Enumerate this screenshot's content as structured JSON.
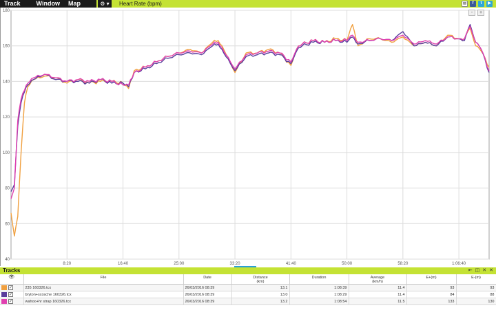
{
  "menu": {
    "items": [
      "Track",
      "Window",
      "Map"
    ]
  },
  "gear_label": "⚙ ▾",
  "chart_title": "Heart Rate (bpm)",
  "zoom": {
    "out": "-",
    "in": "+"
  },
  "colors": {
    "accent": "#c4e234",
    "orange": "#f0a040",
    "purple": "#5a3c9c",
    "magenta": "#e040b0"
  },
  "chart_data": {
    "type": "line",
    "title": "Heart Rate (bpm)",
    "xlabel": "",
    "ylabel": "",
    "ylim": [
      40,
      180
    ],
    "yticks": [
      40,
      60,
      80,
      100,
      120,
      140,
      160,
      180
    ],
    "xlim": [
      0,
      4270
    ],
    "xticks": [
      500,
      1000,
      1500,
      2000,
      2500,
      3000,
      3500,
      4000
    ],
    "xtick_labels": [
      "8:20",
      "16:40",
      "25:00",
      "33:20",
      "41:40",
      "50:00",
      "58:20",
      "1:06:40"
    ],
    "x_unit": "seconds",
    "series": [
      {
        "name": "235 160326.tcx",
        "color": "#f0a040",
        "x": [
          0,
          30,
          60,
          90,
          120,
          150,
          200,
          300,
          400,
          500,
          600,
          700,
          800,
          900,
          1000,
          1050,
          1100,
          1200,
          1300,
          1400,
          1500,
          1600,
          1700,
          1800,
          1850,
          1900,
          2000,
          2100,
          2200,
          2300,
          2400,
          2500,
          2550,
          2600,
          2700,
          2800,
          2900,
          3000,
          3050,
          3100,
          3200,
          3300,
          3400,
          3500,
          3600,
          3700,
          3800,
          3900,
          4000,
          4050,
          4100,
          4150,
          4200,
          4270
        ],
        "y": [
          66,
          53,
          64,
          100,
          128,
          137,
          141,
          143,
          142,
          139,
          141,
          139,
          140,
          140,
          139,
          136,
          146,
          148,
          151,
          154,
          156,
          158,
          156,
          162,
          163,
          158,
          145,
          156,
          156,
          158,
          156,
          149,
          158,
          161,
          163,
          162,
          164,
          163,
          172,
          160,
          164,
          164,
          162,
          165,
          160,
          162,
          160,
          166,
          164,
          164,
          170,
          160,
          157,
          148
        ]
      },
      {
        "name": "bryton+scosche 160326.tcx",
        "color": "#5a3c9c",
        "x": [
          0,
          30,
          60,
          90,
          120,
          150,
          200,
          300,
          400,
          500,
          600,
          700,
          800,
          900,
          1000,
          1050,
          1100,
          1200,
          1300,
          1400,
          1500,
          1600,
          1700,
          1800,
          1850,
          1900,
          2000,
          2100,
          2200,
          2300,
          2400,
          2500,
          2550,
          2600,
          2700,
          2800,
          2900,
          3000,
          3050,
          3100,
          3200,
          3300,
          3400,
          3500,
          3600,
          3700,
          3800,
          3900,
          4000,
          4050,
          4100,
          4150,
          4200,
          4270
        ],
        "y": [
          78,
          82,
          115,
          128,
          134,
          138,
          141,
          144,
          141,
          140,
          140,
          139,
          141,
          139,
          139,
          137,
          145,
          147,
          150,
          153,
          155,
          156,
          155,
          160,
          161,
          156,
          146,
          154,
          155,
          156,
          155,
          150,
          157,
          160,
          162,
          162,
          163,
          162,
          165,
          161,
          163,
          164,
          163,
          168,
          160,
          162,
          160,
          165,
          164,
          163,
          172,
          162,
          158,
          145
        ]
      },
      {
        "name": "wahoo+hr strap 160326.tcx",
        "color": "#e040b0",
        "x": [
          0,
          30,
          60,
          90,
          120,
          150,
          200,
          300,
          400,
          500,
          600,
          700,
          800,
          900,
          1000,
          1050,
          1100,
          1200,
          1300,
          1400,
          1500,
          1600,
          1700,
          1800,
          1850,
          1900,
          2000,
          2100,
          2200,
          2300,
          2400,
          2500,
          2550,
          2600,
          2700,
          2800,
          2900,
          3000,
          3050,
          3100,
          3200,
          3300,
          3400,
          3500,
          3600,
          3700,
          3800,
          3900,
          4000,
          4050,
          4100,
          4150,
          4200,
          4270
        ],
        "y": [
          74,
          80,
          118,
          130,
          135,
          139,
          142,
          144,
          142,
          140,
          141,
          140,
          141,
          140,
          138,
          138,
          145,
          148,
          151,
          154,
          156,
          157,
          156,
          161,
          162,
          157,
          147,
          155,
          156,
          157,
          156,
          151,
          158,
          161,
          163,
          162,
          163,
          163,
          166,
          162,
          163,
          164,
          163,
          166,
          161,
          163,
          161,
          165,
          164,
          164,
          171,
          162,
          158,
          146
        ]
      }
    ]
  },
  "tracks": {
    "title": "Tracks",
    "controls": [
      "⇤",
      "◫",
      "✕",
      "✕"
    ],
    "columns": [
      "",
      "File",
      "Date",
      "Distance\n(km)",
      "Duration",
      "Average\n(km/h)",
      "E+(m)",
      "E-(m)"
    ],
    "eye_icon": "👁",
    "rows": [
      {
        "color": "#f0a040",
        "file": "235 160326.tcx",
        "date": "26/03/2016 08:39",
        "distance": "13.1",
        "duration": "1:08:39",
        "average": "11.4",
        "eplus": "93",
        "eminus": "93"
      },
      {
        "color": "#5a3c9c",
        "file": "bryton+scosche 160326.tcx",
        "date": "26/03/2016 08:39",
        "distance": "13.0",
        "duration": "1:08:29",
        "average": "11.4",
        "eplus": "84",
        "eminus": "88"
      },
      {
        "color": "#e040b0",
        "file": "wahoo+hr strap 160326.tcx",
        "date": "26/03/2016 08:39",
        "distance": "13.2",
        "duration": "1:08:54",
        "average": "11.5",
        "eplus": "133",
        "eminus": "130"
      }
    ]
  }
}
